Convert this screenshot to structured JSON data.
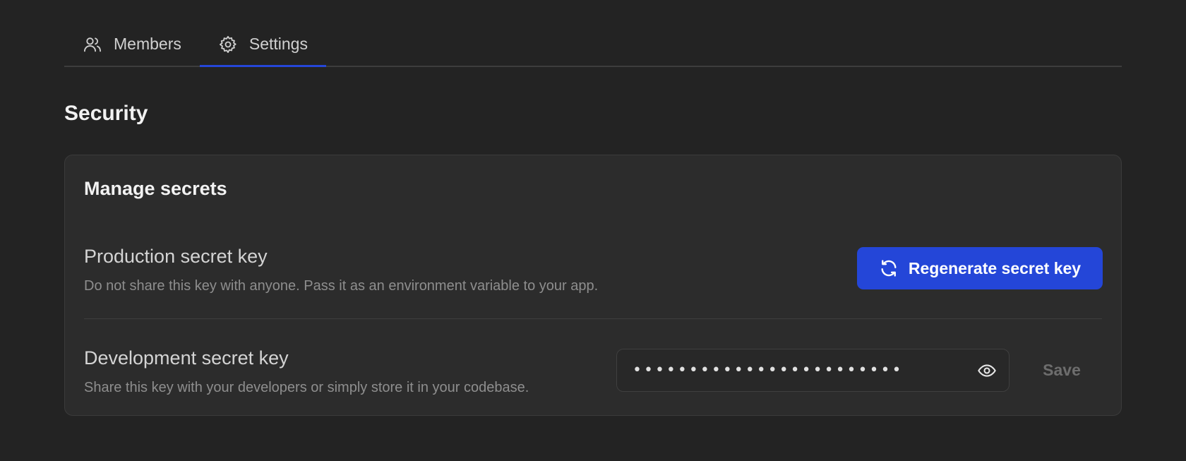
{
  "tabs": [
    {
      "label": "Members",
      "icon": "users-icon",
      "active": false
    },
    {
      "label": "Settings",
      "icon": "gear-icon",
      "active": true
    }
  ],
  "section": {
    "title": "Security"
  },
  "card": {
    "title": "Manage secrets",
    "production": {
      "title": "Production secret key",
      "description": "Do not share this key with anyone. Pass it as an environment variable to your app.",
      "regenerate_label": "Regenerate secret key",
      "regenerate_icon": "refresh-icon"
    },
    "development": {
      "title": "Development secret key",
      "description": "Share this key with your developers or simply store it in your codebase.",
      "secret_value": "************************",
      "toggle_icon": "eye-icon",
      "save_label": "Save"
    }
  },
  "colors": {
    "background": "#232323",
    "card": "#2c2c2c",
    "accent": "#2446d8"
  }
}
